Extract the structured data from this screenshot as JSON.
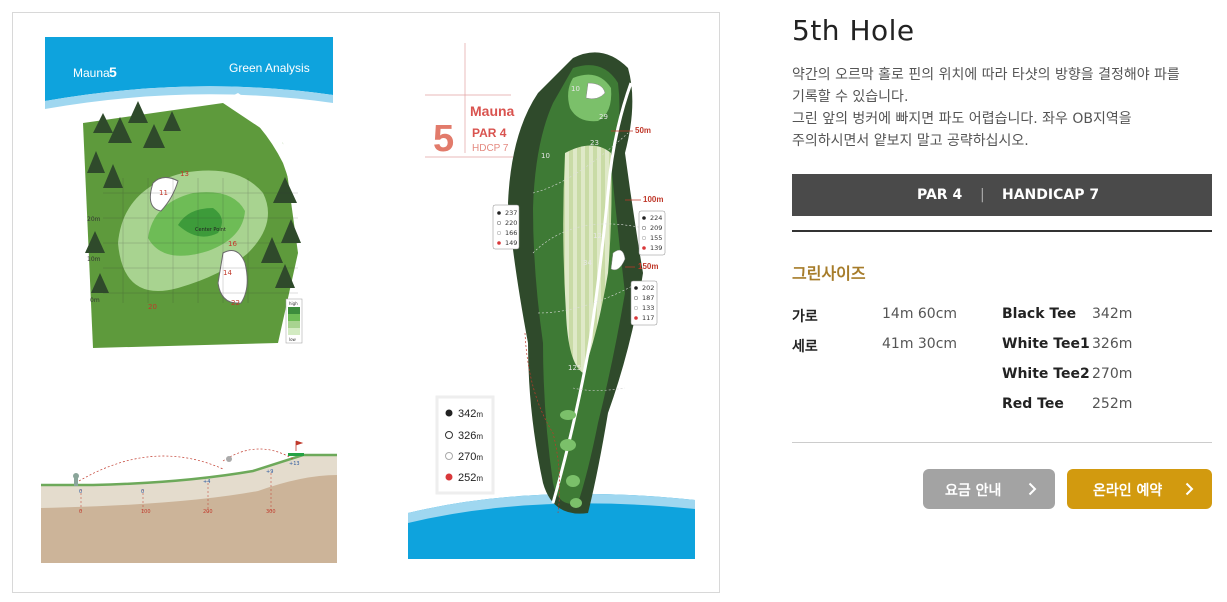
{
  "colors": {
    "accent": "#a67c2a",
    "spec_bar": "#4a4a4a",
    "fee_button": "#a3a3a3",
    "book_button": "#d29a0f",
    "map_blue": "#0ea3dd"
  },
  "green_panel": {
    "course": "Mauna",
    "hole_number": "5",
    "caption": "Green Analysis",
    "pin_label": "Center Point",
    "numbers": [
      "13",
      "11",
      "16",
      "14",
      "20",
      "22"
    ],
    "distance_labels": [
      "20m",
      "10m",
      "0m"
    ],
    "legend_top": "high",
    "legend_bottom": "low"
  },
  "profile": {
    "ticks": [
      "0",
      "100",
      "200",
      "300"
    ],
    "elevations": [
      "0",
      "0",
      "+4",
      "+9",
      "+13"
    ]
  },
  "layout_map": {
    "course": "Mauna",
    "hole_number": "5",
    "par_text": "PAR 4",
    "hdcp_text": "HDCP 7",
    "distance_markers": [
      "50m",
      "100m",
      "150m"
    ],
    "yardage_left": [
      "237",
      "220",
      "166",
      "149"
    ],
    "yardage_right_upper": [
      "224",
      "209",
      "155",
      "139"
    ],
    "yardage_right_lower": [
      "202",
      "187",
      "133",
      "117"
    ],
    "pin_markers": [
      "10",
      "29",
      "23",
      "10",
      "34",
      "12",
      "125"
    ],
    "tee_legend": [
      {
        "value": "342",
        "unit": "m"
      },
      {
        "value": "326",
        "unit": "m"
      },
      {
        "value": "270",
        "unit": "m"
      },
      {
        "value": "252",
        "unit": "m"
      }
    ]
  },
  "hole": {
    "title": "5th Hole",
    "description": [
      "약간의 오르막 홀로 핀의 위치에 따라 타샷의 방향을 결정해야 파를",
      "기록할 수 있습니다.",
      "그린 앞의 벙커에 빠지면 파도 어렵습니다. 좌우 OB지역을",
      "주의하시면서 얕보지 말고 공략하십시오."
    ]
  },
  "specs": {
    "par": "PAR 4",
    "separator": "|",
    "handicap": "HANDICAP 7"
  },
  "green_size": {
    "title": "그린사이즈",
    "dimensions": [
      {
        "label": "가로",
        "value": "14m 60cm"
      },
      {
        "label": "세로",
        "value": "41m 30cm"
      }
    ],
    "tees": [
      {
        "label": "Black Tee",
        "value": "342m"
      },
      {
        "label": "White Tee1",
        "value": "326m"
      },
      {
        "label": "White Tee2",
        "value": "270m"
      },
      {
        "label": "Red Tee",
        "value": "252m"
      }
    ]
  },
  "buttons": {
    "fee": "요금 안내",
    "booking": "온라인 예약"
  }
}
